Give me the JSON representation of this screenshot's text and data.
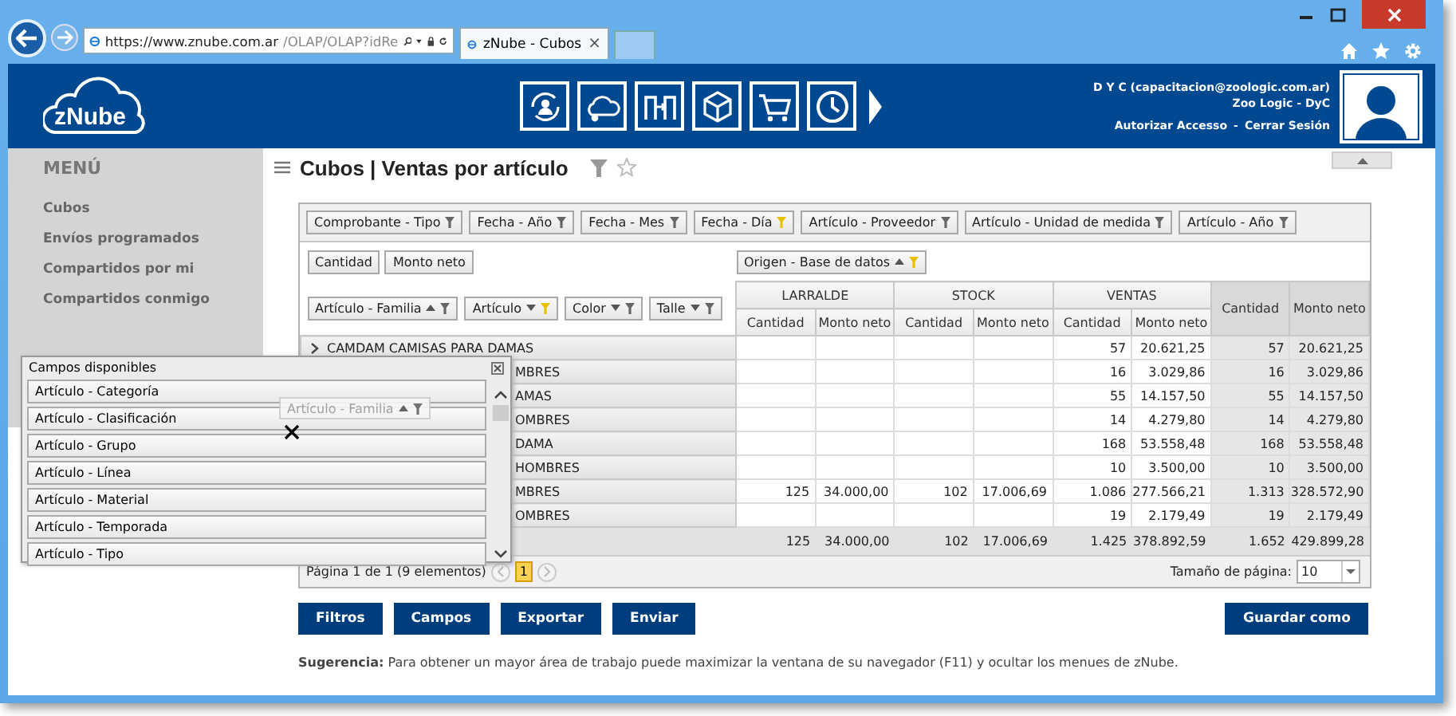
{
  "browser": {
    "address_host": "https://www.znube.com.ar",
    "address_path": "/OLAP/OLAP?idRe",
    "tab_title": "zNube - Cubos",
    "tab_close": "×"
  },
  "header": {
    "logo": "zNube",
    "user": "D Y C (capacitacion@zoologic.com.ar)",
    "company": "Zoo Logic - DyC",
    "links": [
      "Autorizar Accesso",
      "Cerrar Sesión"
    ],
    "separator": "-"
  },
  "sidebar": {
    "title": "MENÚ",
    "items": [
      "Cubos",
      "Envíos programados",
      "Compartidos por mi",
      "Compartidos conmigo"
    ]
  },
  "page": {
    "title": "Cubos | Ventas por artículo"
  },
  "pivot": {
    "filter_fields": [
      {
        "label": "Comprobante - Tipo",
        "filtered": false
      },
      {
        "label": "Fecha - Año",
        "filtered": false
      },
      {
        "label": "Fecha - Mes",
        "filtered": false
      },
      {
        "label": "Fecha - Día",
        "filtered": true
      },
      {
        "label": "Artículo - Proveedor",
        "filtered": false
      },
      {
        "label": "Artículo - Unidad de medida",
        "filtered": false
      },
      {
        "label": "Artículo - Año",
        "filtered": false
      }
    ],
    "data_fields": [
      "Cantidad",
      "Monto neto"
    ],
    "column_fields": [
      {
        "label": "Origen - Base de datos",
        "ascending": true,
        "filtered": true
      }
    ],
    "row_fields": [
      {
        "label": "Artículo - Familia",
        "ascending": true,
        "filtered": false
      },
      {
        "label": "Artículo",
        "ascending": false,
        "filtered": true
      },
      {
        "label": "Color",
        "ascending": false,
        "filtered": false
      },
      {
        "label": "Talle",
        "ascending": false,
        "filtered": false
      }
    ],
    "column_groups": [
      {
        "label": "LARRALDE",
        "columns": [
          "Cantidad",
          "Monto neto"
        ]
      },
      {
        "label": "STOCK",
        "columns": [
          "Cantidad",
          "Monto neto"
        ]
      },
      {
        "label": "VENTAS",
        "columns": [
          "Cantidad",
          "Monto neto"
        ]
      }
    ],
    "total_columns": [
      "Cantidad",
      "Monto neto"
    ],
    "rows": [
      {
        "label": "CAMDAM CAMISAS PARA DAMAS",
        "kind": "full",
        "values": [
          "57",
          "20.621,25",
          "57",
          "20.621,25"
        ]
      },
      {
        "label": "MBRES",
        "kind": "covered",
        "values": [
          "16",
          "3.029,86",
          "16",
          "3.029,86"
        ]
      },
      {
        "label": "AMAS",
        "kind": "covered",
        "values": [
          "55",
          "14.157,50",
          "55",
          "14.157,50"
        ]
      },
      {
        "label": "OMBRES",
        "kind": "covered",
        "values": [
          "14",
          "4.279,80",
          "14",
          "4.279,80"
        ]
      },
      {
        "label": "DAMA",
        "kind": "covered",
        "values": [
          "168",
          "53.558,48",
          "168",
          "53.558,48"
        ]
      },
      {
        "label": "HOMBRES",
        "kind": "covered",
        "values": [
          "10",
          "3.500,00",
          "10",
          "3.500,00"
        ]
      },
      {
        "label": "MBRES",
        "kind": "covered",
        "values": [
          "125",
          "34.000,00",
          "102",
          "17.006,69",
          "1.086",
          "277.566,21",
          "1.313",
          "328.572,90"
        ]
      },
      {
        "label": "OMBRES",
        "kind": "covered",
        "values": [
          "19",
          "2.179,49",
          "19",
          "2.179,49"
        ]
      }
    ],
    "totals": [
      "125",
      "34.000,00",
      "102",
      "17.006,69",
      "1.425",
      "378.892,59",
      "1.652",
      "429.899,28"
    ]
  },
  "pager": {
    "summary": "Página 1 de 1 (9 elementos)",
    "pages": [
      {
        "label": "1",
        "selected": true
      }
    ],
    "page_size_label": "Tamaño de página:",
    "page_size": "10"
  },
  "buttons": [
    "Filtros",
    "Campos",
    "Exportar",
    "Enviar"
  ],
  "save_button": "Guardar como",
  "hint": "**Sugerencia:** Para obtener un mayor área de trabajo puede maximizar la ventana de su navegador (F11) y ocultar los menues de zNube.",
  "panel": {
    "title": "Campos disponibles",
    "fields": [
      "Artículo - Categoría",
      "Artículo - Clasificación",
      "Artículo - Grupo",
      "Artículo - Línea",
      "Artículo - Material",
      "Artículo - Temporada",
      "Artículo - Tipo"
    ]
  },
  "drag_ghost": {
    "label": "Artículo - Familia",
    "ascending": true,
    "filtered": false
  }
}
